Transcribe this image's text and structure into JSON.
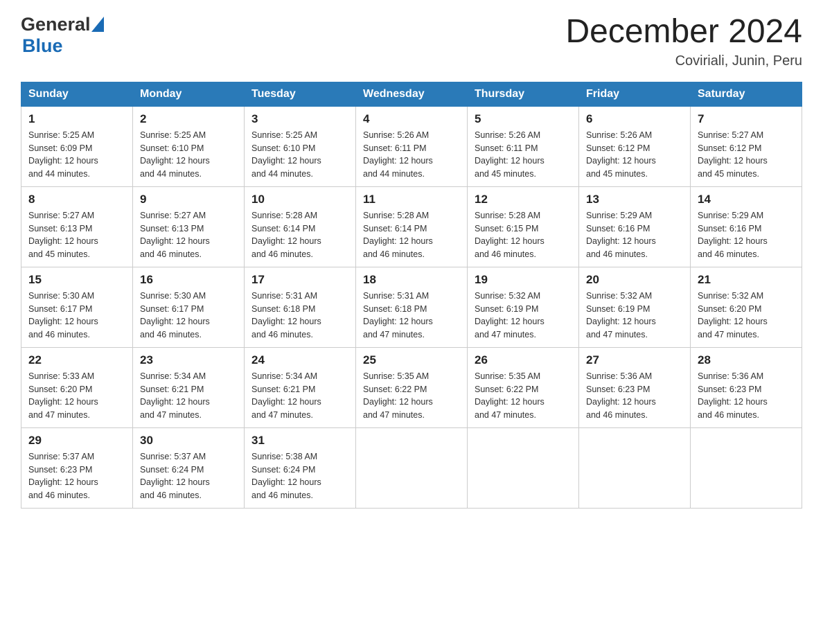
{
  "header": {
    "logo_general": "General",
    "logo_blue": "Blue",
    "title": "December 2024",
    "subtitle": "Coviriali, Junin, Peru"
  },
  "days_of_week": [
    "Sunday",
    "Monday",
    "Tuesday",
    "Wednesday",
    "Thursday",
    "Friday",
    "Saturday"
  ],
  "weeks": [
    [
      {
        "day": "1",
        "sunrise": "5:25 AM",
        "sunset": "6:09 PM",
        "daylight": "12 hours and 44 minutes."
      },
      {
        "day": "2",
        "sunrise": "5:25 AM",
        "sunset": "6:10 PM",
        "daylight": "12 hours and 44 minutes."
      },
      {
        "day": "3",
        "sunrise": "5:25 AM",
        "sunset": "6:10 PM",
        "daylight": "12 hours and 44 minutes."
      },
      {
        "day": "4",
        "sunrise": "5:26 AM",
        "sunset": "6:11 PM",
        "daylight": "12 hours and 44 minutes."
      },
      {
        "day": "5",
        "sunrise": "5:26 AM",
        "sunset": "6:11 PM",
        "daylight": "12 hours and 45 minutes."
      },
      {
        "day": "6",
        "sunrise": "5:26 AM",
        "sunset": "6:12 PM",
        "daylight": "12 hours and 45 minutes."
      },
      {
        "day": "7",
        "sunrise": "5:27 AM",
        "sunset": "6:12 PM",
        "daylight": "12 hours and 45 minutes."
      }
    ],
    [
      {
        "day": "8",
        "sunrise": "5:27 AM",
        "sunset": "6:13 PM",
        "daylight": "12 hours and 45 minutes."
      },
      {
        "day": "9",
        "sunrise": "5:27 AM",
        "sunset": "6:13 PM",
        "daylight": "12 hours and 46 minutes."
      },
      {
        "day": "10",
        "sunrise": "5:28 AM",
        "sunset": "6:14 PM",
        "daylight": "12 hours and 46 minutes."
      },
      {
        "day": "11",
        "sunrise": "5:28 AM",
        "sunset": "6:14 PM",
        "daylight": "12 hours and 46 minutes."
      },
      {
        "day": "12",
        "sunrise": "5:28 AM",
        "sunset": "6:15 PM",
        "daylight": "12 hours and 46 minutes."
      },
      {
        "day": "13",
        "sunrise": "5:29 AM",
        "sunset": "6:16 PM",
        "daylight": "12 hours and 46 minutes."
      },
      {
        "day": "14",
        "sunrise": "5:29 AM",
        "sunset": "6:16 PM",
        "daylight": "12 hours and 46 minutes."
      }
    ],
    [
      {
        "day": "15",
        "sunrise": "5:30 AM",
        "sunset": "6:17 PM",
        "daylight": "12 hours and 46 minutes."
      },
      {
        "day": "16",
        "sunrise": "5:30 AM",
        "sunset": "6:17 PM",
        "daylight": "12 hours and 46 minutes."
      },
      {
        "day": "17",
        "sunrise": "5:31 AM",
        "sunset": "6:18 PM",
        "daylight": "12 hours and 46 minutes."
      },
      {
        "day": "18",
        "sunrise": "5:31 AM",
        "sunset": "6:18 PM",
        "daylight": "12 hours and 47 minutes."
      },
      {
        "day": "19",
        "sunrise": "5:32 AM",
        "sunset": "6:19 PM",
        "daylight": "12 hours and 47 minutes."
      },
      {
        "day": "20",
        "sunrise": "5:32 AM",
        "sunset": "6:19 PM",
        "daylight": "12 hours and 47 minutes."
      },
      {
        "day": "21",
        "sunrise": "5:32 AM",
        "sunset": "6:20 PM",
        "daylight": "12 hours and 47 minutes."
      }
    ],
    [
      {
        "day": "22",
        "sunrise": "5:33 AM",
        "sunset": "6:20 PM",
        "daylight": "12 hours and 47 minutes."
      },
      {
        "day": "23",
        "sunrise": "5:34 AM",
        "sunset": "6:21 PM",
        "daylight": "12 hours and 47 minutes."
      },
      {
        "day": "24",
        "sunrise": "5:34 AM",
        "sunset": "6:21 PM",
        "daylight": "12 hours and 47 minutes."
      },
      {
        "day": "25",
        "sunrise": "5:35 AM",
        "sunset": "6:22 PM",
        "daylight": "12 hours and 47 minutes."
      },
      {
        "day": "26",
        "sunrise": "5:35 AM",
        "sunset": "6:22 PM",
        "daylight": "12 hours and 47 minutes."
      },
      {
        "day": "27",
        "sunrise": "5:36 AM",
        "sunset": "6:23 PM",
        "daylight": "12 hours and 46 minutes."
      },
      {
        "day": "28",
        "sunrise": "5:36 AM",
        "sunset": "6:23 PM",
        "daylight": "12 hours and 46 minutes."
      }
    ],
    [
      {
        "day": "29",
        "sunrise": "5:37 AM",
        "sunset": "6:23 PM",
        "daylight": "12 hours and 46 minutes."
      },
      {
        "day": "30",
        "sunrise": "5:37 AM",
        "sunset": "6:24 PM",
        "daylight": "12 hours and 46 minutes."
      },
      {
        "day": "31",
        "sunrise": "5:38 AM",
        "sunset": "6:24 PM",
        "daylight": "12 hours and 46 minutes."
      },
      null,
      null,
      null,
      null
    ]
  ],
  "labels": {
    "sunrise": "Sunrise:",
    "sunset": "Sunset:",
    "daylight": "Daylight:"
  }
}
